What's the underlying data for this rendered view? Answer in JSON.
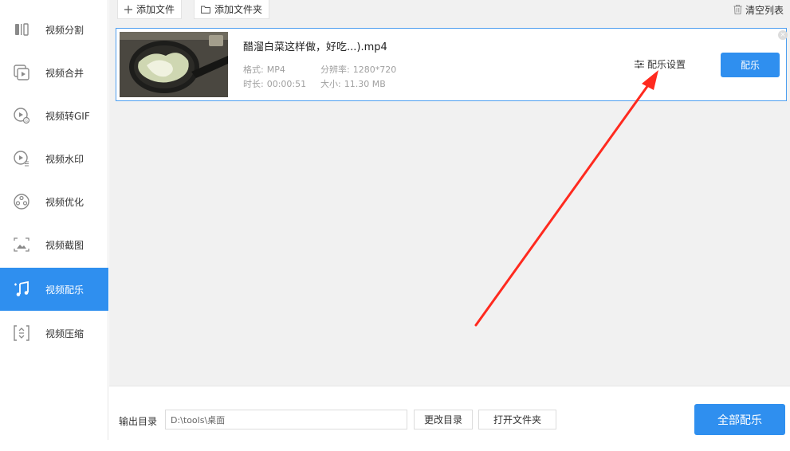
{
  "sidebar": {
    "items": [
      {
        "label": "视频分割",
        "icon": "split-icon"
      },
      {
        "label": "视频合并",
        "icon": "merge-icon"
      },
      {
        "label": "视频转GIF",
        "icon": "gif-icon"
      },
      {
        "label": "视频水印",
        "icon": "watermark-icon"
      },
      {
        "label": "视频优化",
        "icon": "optimize-icon"
      },
      {
        "label": "视频截图",
        "icon": "screenshot-icon"
      },
      {
        "label": "视频配乐",
        "icon": "music-icon",
        "active": true
      },
      {
        "label": "视频压缩",
        "icon": "compress-icon"
      }
    ]
  },
  "toolbar": {
    "add_file": "添加文件",
    "add_folder": "添加文件夹",
    "clear_list": "清空列表"
  },
  "file": {
    "name": "醋溜白菜这样做，好吃...).mp4",
    "format_label": "格式:",
    "format_value": "MP4",
    "resolution_label": "分辨率:",
    "resolution_value": "1280*720",
    "duration_label": "时长:",
    "duration_value": "00:00:51",
    "size_label": "大小:",
    "size_value": "11.30 MB",
    "settings_label": "配乐设置",
    "action_label": "配乐"
  },
  "bottom": {
    "output_label": "输出目录",
    "output_path": "D:\\tools\\桌面",
    "change_dir": "更改目录",
    "open_folder": "打开文件夹",
    "process_all": "全部配乐"
  },
  "colors": {
    "accent": "#2f8fef",
    "annotation_arrow": "#ff2a1f"
  }
}
